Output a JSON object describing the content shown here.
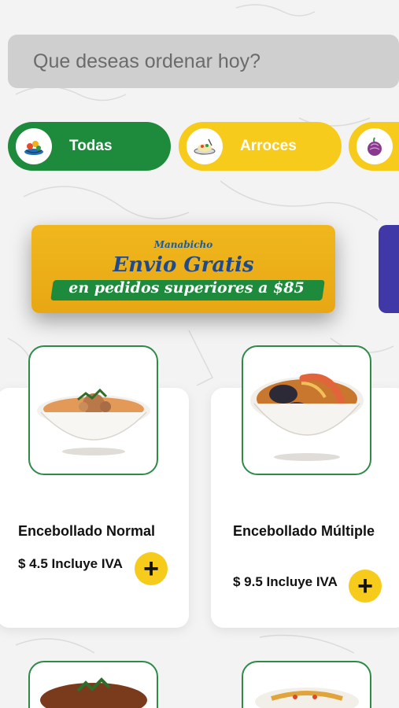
{
  "search": {
    "placeholder": "Que deseas ordenar hoy?"
  },
  "categories": [
    {
      "label": "Todas",
      "icon": "seafood-platter-icon",
      "color": "#1e8a3c",
      "selected": true
    },
    {
      "label": "Arroces",
      "icon": "rice-dish-icon",
      "color": "#f6cb1c",
      "selected": false
    },
    {
      "label": "",
      "icon": "onion-icon",
      "color": "#f6cb1c",
      "selected": false
    }
  ],
  "banner": {
    "brand": "Manabicho",
    "headline": "Envio Gratis",
    "subline": "en pedidos superiores a $85"
  },
  "products": [
    {
      "name": "Encebollado Normal",
      "price": "$ 4.5 Incluye IVA",
      "image": "fish-soup-bowl",
      "add_icon": "plus-icon"
    },
    {
      "name": "Encebollado Múltiple",
      "price": "$ 9.5 Incluye IVA",
      "image": "seafood-soup-bowl",
      "add_icon": "plus-icon"
    }
  ],
  "colors": {
    "primary_green": "#1e8a3c",
    "accent_yellow": "#f6cb1c",
    "background": "#f3f3f3"
  }
}
